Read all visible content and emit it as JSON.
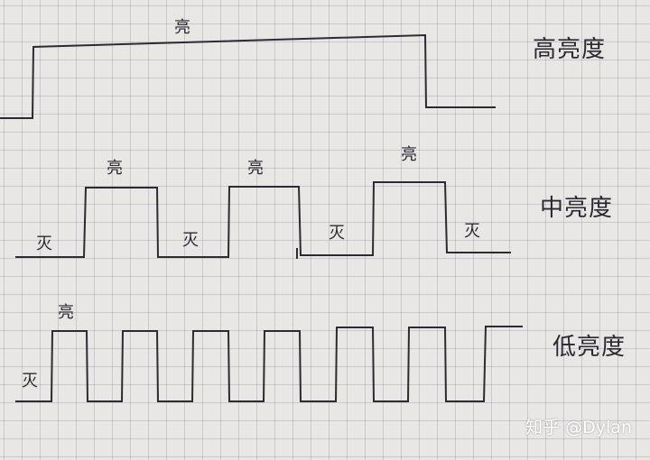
{
  "labels": {
    "on": "亮",
    "off": "灭"
  },
  "rows": {
    "high": {
      "title": "高亮度"
    },
    "medium": {
      "title": "中亮度"
    },
    "low": {
      "title": "低亮度"
    }
  },
  "watermark": "知乎 @Dylan"
}
